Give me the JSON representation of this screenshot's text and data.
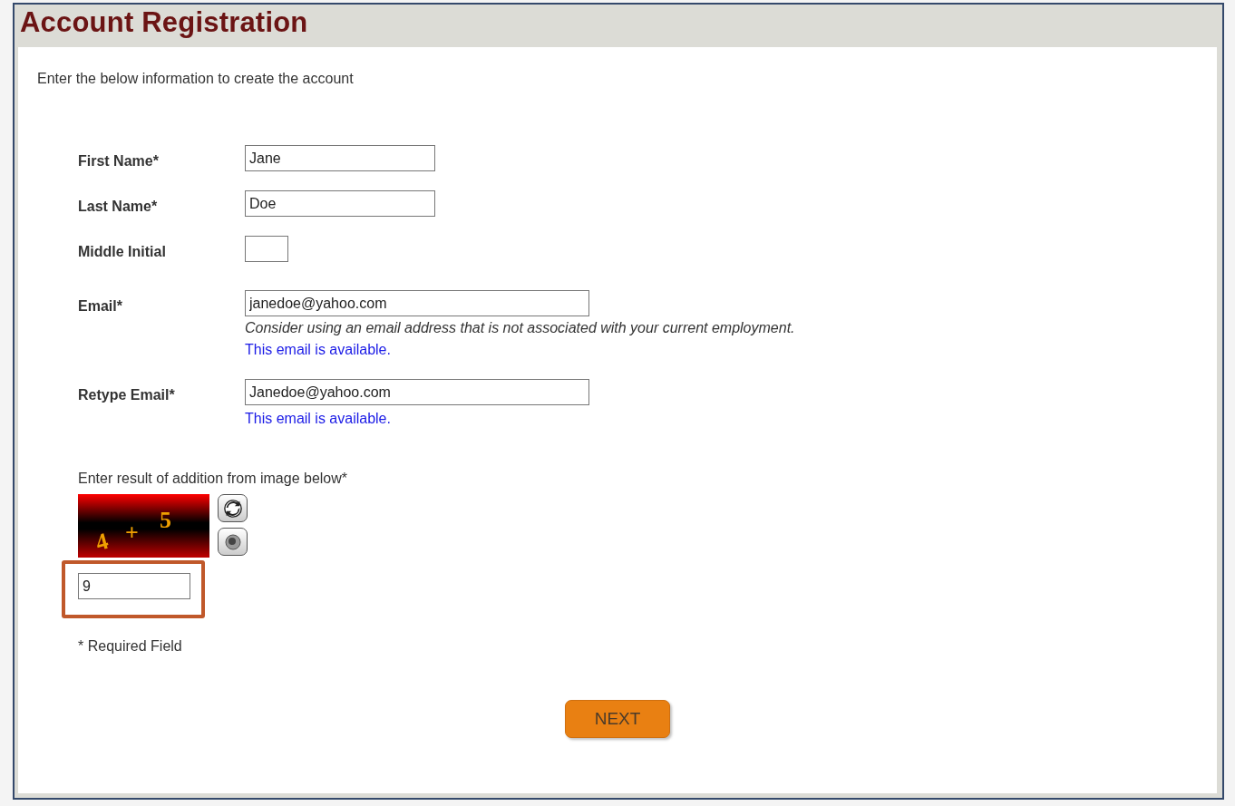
{
  "title": "Account Registration",
  "intro": "Enter the below information to create the account",
  "fields": [
    {
      "label": "First Name*",
      "value": "Jane",
      "kind": "name"
    },
    {
      "label": "Last Name*",
      "value": "Doe",
      "kind": "name"
    },
    {
      "label": "Middle Initial",
      "kind": "initial"
    },
    {
      "label": "Email*",
      "value": "janedoe@yahoo.com",
      "kind": "email",
      "hint": "Consider using an email address that is not associated with your current employment.",
      "status": "This email is available."
    },
    {
      "label": "Retype Email*",
      "value": "Janedoe@yahoo.com",
      "kind": "email",
      "status": "This email is available."
    }
  ],
  "captcha": {
    "label": "Enter result of addition from image below*",
    "operand_1": "4",
    "operator": "+",
    "operand_2": "5",
    "answer": "9",
    "highlighted": true
  },
  "required_note": "* Required Field",
  "next_button": "NEXT"
}
